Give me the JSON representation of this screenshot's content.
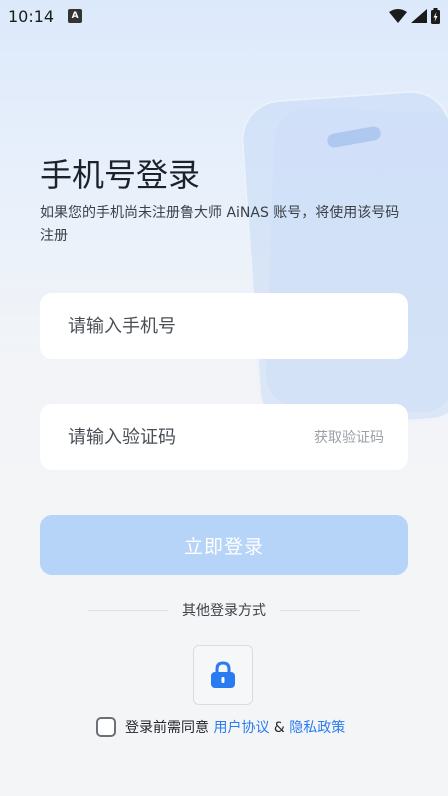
{
  "status_bar": {
    "time": "10:14",
    "notification_icon": "A"
  },
  "title": "手机号登录",
  "subtitle": "如果您的手机尚未注册鲁大师 AiNAS 账号，将使用该号码注册",
  "phone_input": {
    "placeholder": "请输入手机号",
    "value": ""
  },
  "code_input": {
    "placeholder": "请输入验证码",
    "value": "",
    "get_code_label": "获取验证码"
  },
  "login_button": {
    "label": "立即登录"
  },
  "other_login": {
    "label": "其他登录方式",
    "icon": "lock-icon"
  },
  "agreement": {
    "prefix": "登录前需同意",
    "user_agreement": "用户协议",
    "separator": "&",
    "privacy_policy": "隐私政策",
    "checked": false
  },
  "colors": {
    "primary": "#2b7bf0",
    "button_disabled": "#b6d3f8",
    "background": "#f4f5f7"
  }
}
